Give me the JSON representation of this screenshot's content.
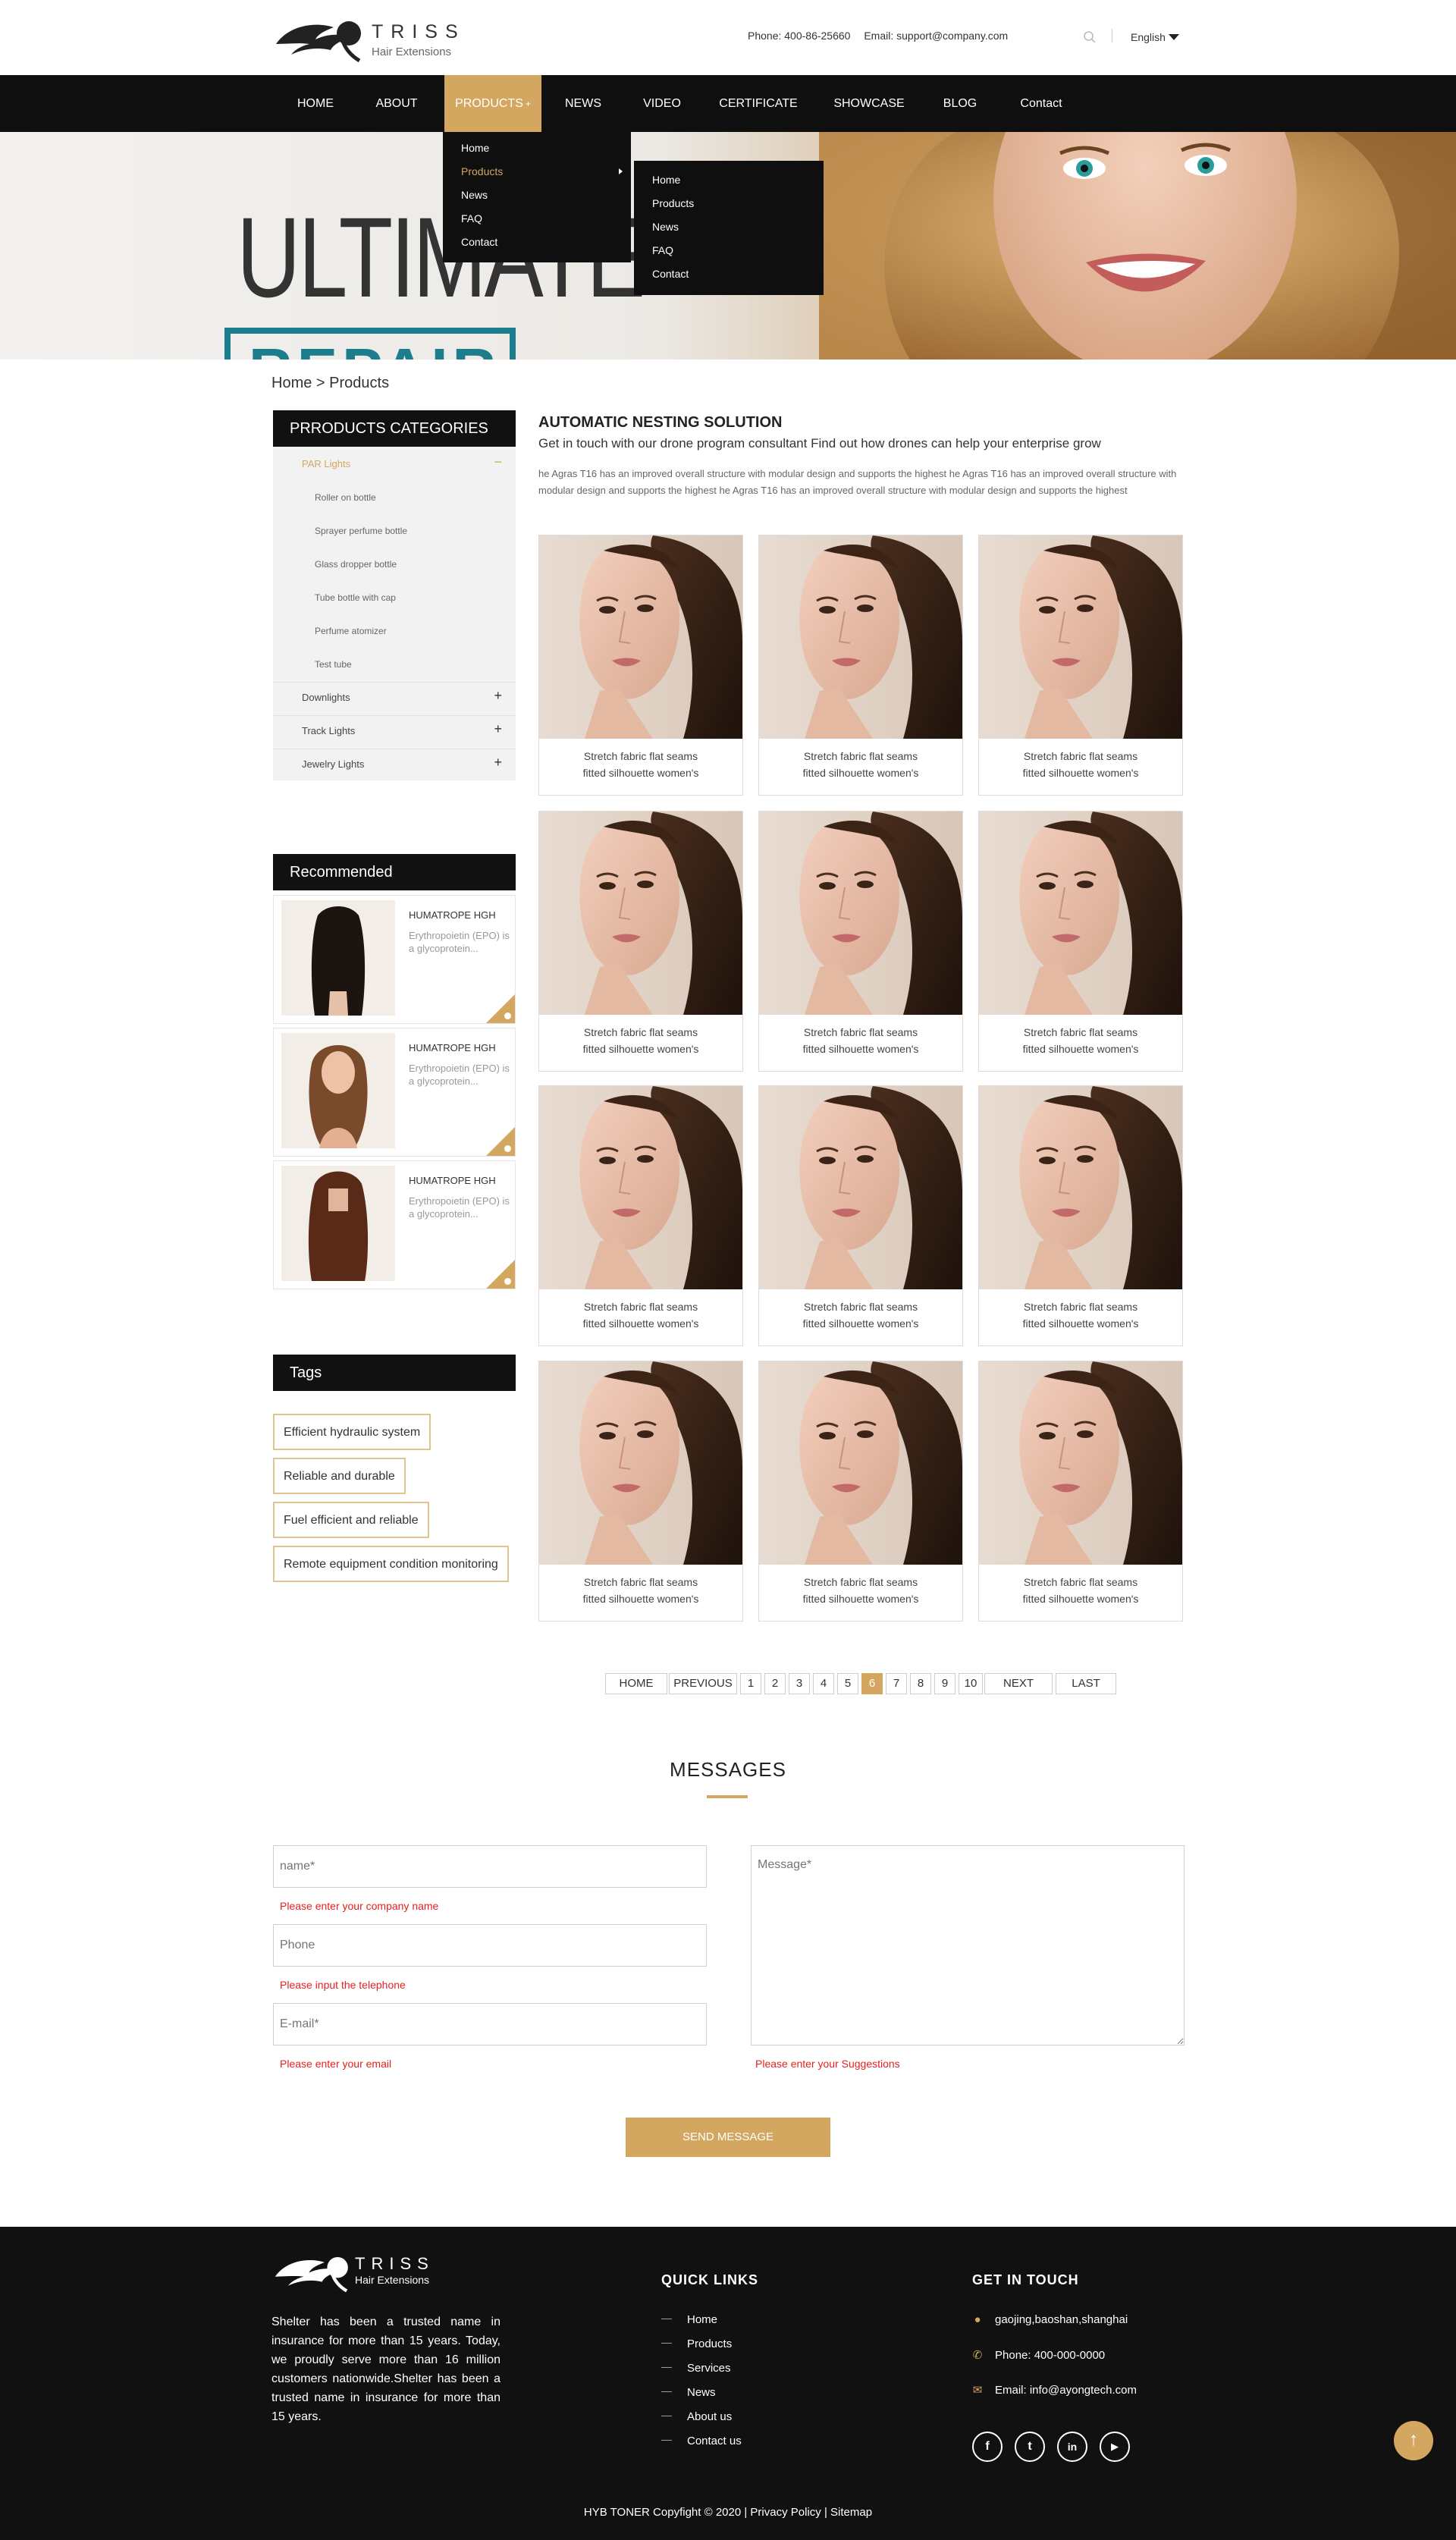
{
  "header": {
    "brand": "TRISS",
    "brand_sub": "Hair Extensions",
    "phone": "Phone: 400-86-25660",
    "email": "Email: support@company.com",
    "language": "English"
  },
  "nav": {
    "items": [
      "HOME",
      "ABOUT",
      "PRODUCTS",
      "NEWS",
      "VIDEO",
      "CERTIFICATE",
      "SHOWCASE",
      "BLOG",
      "Contact"
    ],
    "active_plus": "+"
  },
  "dropdown_1": [
    "Home",
    "Products",
    "News",
    "FAQ",
    "Contact"
  ],
  "dropdown_2": [
    "Home",
    "Products",
    "News",
    "FAQ",
    "Contact"
  ],
  "hero": {
    "title": "ULTIMATE",
    "box_text": "REPAIR"
  },
  "breadcrumb": "Home > Products",
  "sidebar": {
    "categories_title": "PRRODUCTS CATEGORIES",
    "open_category": "PAR Lights",
    "open_sign": "−",
    "subitems": [
      "Roller on bottle",
      "Sprayer perfume bottle",
      "Glass dropper bottle",
      "Tube bottle with cap",
      "Perfume atomizer",
      "Test tube"
    ],
    "categories": [
      "Downlights",
      "Track Lights",
      "Jewelry Lights"
    ],
    "plus_sign": "+",
    "recommended_title": "Recommended",
    "recommended": [
      {
        "title": "HUMATROPE HGH",
        "desc": "Erythropoietin (EPO) is a glycoprotein..."
      },
      {
        "title": "HUMATROPE HGH",
        "desc": "Erythropoietin (EPO) is a glycoprotein..."
      },
      {
        "title": "HUMATROPE HGH",
        "desc": "Erythropoietin (EPO) is a glycoprotein..."
      }
    ],
    "tags_title": "Tags",
    "tags": [
      "Efficient hydraulic system",
      "Reliable and durable",
      "Fuel efficient and reliable",
      "Remote equipment condition monitoring"
    ]
  },
  "main": {
    "title": "AUTOMATIC NESTING SOLUTION",
    "subtitle": "Get in touch with our drone program consultant Find out how drones can help your enterprise grow",
    "description": "he Agras T16 has an improved overall structure with modular design and supports the highest he Agras T16 has an improved overall structure with modular design and supports the highest he Agras T16 has an improved overall structure with modular design and supports the highest",
    "product_caption_1": "Stretch fabric flat seams",
    "product_caption_2": "fitted silhouette women's"
  },
  "pagination": {
    "home": "HOME",
    "previous": "PREVIOUS",
    "pages": [
      "1",
      "2",
      "3",
      "4",
      "5",
      "6",
      "7",
      "8",
      "9",
      "10"
    ],
    "current": "6",
    "next": "NEXT",
    "last": "LAST"
  },
  "messages": {
    "title": "MESSAGES",
    "name_placeholder": "name*",
    "name_error": "Please enter your company name",
    "phone_placeholder": "Phone",
    "phone_error": "Please input the telephone",
    "email_placeholder": "E-mail*",
    "email_error": "Please enter your email",
    "message_placeholder": "Message*",
    "message_error": "Please enter your Suggestions",
    "send": "SEND MESSAGE"
  },
  "footer": {
    "brand": "TRISS",
    "brand_sub": "Hair Extensions",
    "about": "Shelter has been a trusted name in insurance for more than 15 years. Today, we proudly serve more than 16 million customers nationwide.Shelter has been a trusted name in insurance for more than 15 years.",
    "quick_links_title": "QUICK LINKS",
    "quick_links": [
      "Home",
      "Products",
      "Services",
      "News",
      "About us",
      "Contact us"
    ],
    "touch_title": "GET IN TOUCH",
    "address": "gaojing,baoshan,shanghai",
    "phone": "Phone: 400-000-0000",
    "email": "Email: info@ayongtech.com",
    "social": [
      "f",
      "t",
      "in",
      "▶"
    ],
    "copyright": "HYB TONER Copyfight © 2020 |",
    "privacy": "Privacy Policy",
    "sep": "|",
    "sitemap": "Sitemap"
  },
  "colors": {
    "accent": "#d3a760",
    "nav_bg": "#0f0f10",
    "footer_bg": "#111112",
    "error": "#e3211f",
    "hero_teal": "#1d7d8c"
  },
  "icons": [
    "search-icon",
    "caret-down-icon",
    "location-icon",
    "phone-icon",
    "mail-icon",
    "arrow-up-icon"
  ]
}
